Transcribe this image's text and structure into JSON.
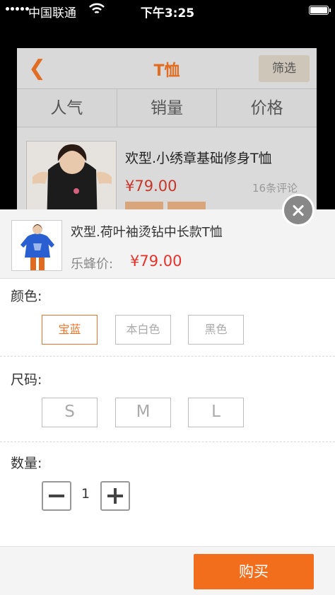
{
  "status_bar": {
    "carrier": "中国联通",
    "time": "下午3:25"
  },
  "background_page": {
    "title": "T恤",
    "filter_label": "筛选",
    "sort_tabs": [
      "人气",
      "销量",
      "价格"
    ],
    "item": {
      "title": "欢型.小绣章基础修身T恤",
      "price": "¥79.00",
      "reviews": "16条评论"
    }
  },
  "sheet": {
    "product_title": "欢型.荷叶袖烫钻中长款T恤",
    "price_label": "乐蜂价:",
    "price_value": "¥79.00",
    "color": {
      "label": "颜色:",
      "options": [
        "宝蓝",
        "本白色",
        "黑色"
      ],
      "selected": "宝蓝"
    },
    "size": {
      "label": "尺码:",
      "options": [
        "S",
        "M",
        "L"
      ]
    },
    "quantity": {
      "label": "数量:",
      "value": "1"
    },
    "buy_label": "购买"
  },
  "colors": {
    "accent": "#f26d1c",
    "price": "#e8312a",
    "selected_option": "#e8742a"
  }
}
